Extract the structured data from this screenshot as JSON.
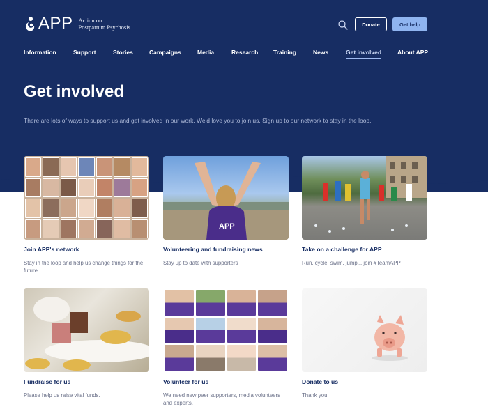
{
  "brand": {
    "name": "APP",
    "subtitle_line1": "Action on",
    "subtitle_line2": "Postpartum Psychosis"
  },
  "header": {
    "donate_label": "Donate",
    "gethelp_label": "Get help"
  },
  "nav": [
    {
      "label": "Information",
      "active": false
    },
    {
      "label": "Support",
      "active": false
    },
    {
      "label": "Stories",
      "active": false
    },
    {
      "label": "Campaigns",
      "active": false
    },
    {
      "label": "Media",
      "active": false
    },
    {
      "label": "Research",
      "active": false
    },
    {
      "label": "Training",
      "active": false
    },
    {
      "label": "News",
      "active": false
    },
    {
      "label": "Get involved",
      "active": true
    },
    {
      "label": "About APP",
      "active": false
    }
  ],
  "hero": {
    "title": "Get involved",
    "intro": "There are lots of ways to support us and get involved in our work. We'd love you to join us. Sign up to our network to stay in the loop."
  },
  "cards": [
    {
      "title": "Join APP's network",
      "desc": "Stay in the loop and help us change things for the future."
    },
    {
      "title": "Volunteering and fundraising news",
      "desc": "Stay up to date with supporters"
    },
    {
      "title": "Take on a challenge for APP",
      "desc": "Run, cycle, swim, jump... join #TeamAPP"
    },
    {
      "title": "Fundraise for us",
      "desc": "Please help us raise vital funds."
    },
    {
      "title": "Volunteer for us",
      "desc": "We need new peer supporters, media volunteers and experts."
    },
    {
      "title": "Donate to us",
      "desc": "Thank you"
    }
  ],
  "colors": {
    "navy": "#172d63",
    "accent": "#8fb4f0",
    "shirt": "#4a2d8a"
  }
}
